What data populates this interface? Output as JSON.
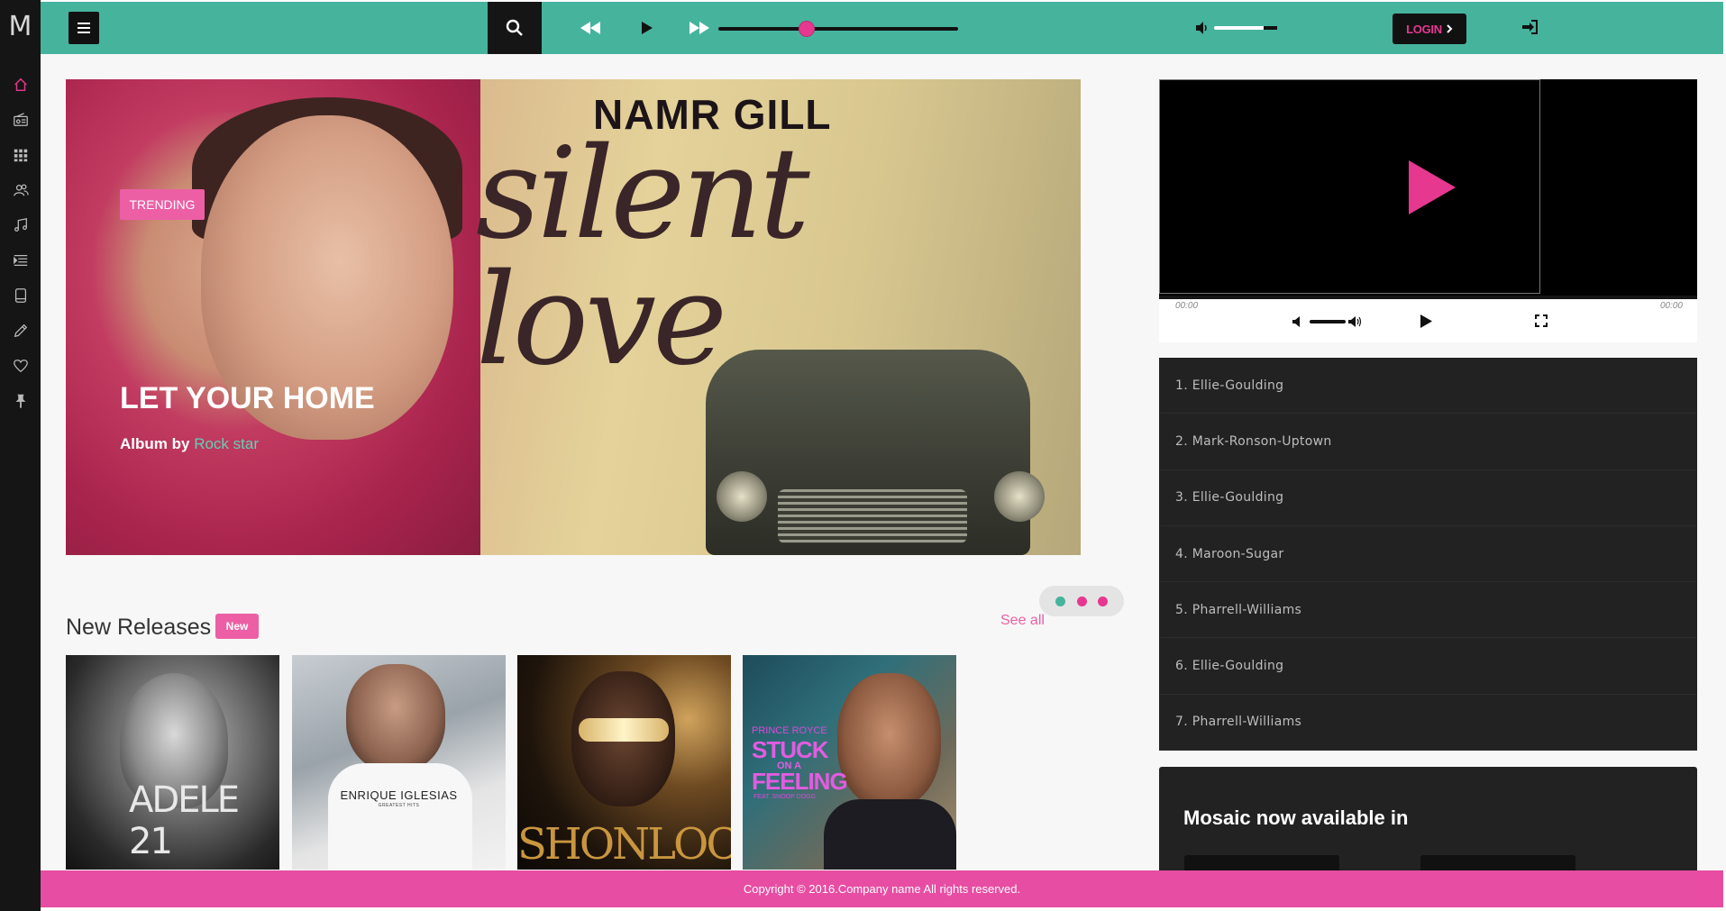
{
  "app": {
    "logo_letter": "M"
  },
  "sidebar": {
    "items": [
      {
        "icon": "home-icon",
        "color": "#e6388f"
      },
      {
        "icon": "radio-icon"
      },
      {
        "icon": "grid-icon"
      },
      {
        "icon": "users-icon"
      },
      {
        "icon": "music-note-icon"
      },
      {
        "icon": "playlist-icon"
      },
      {
        "icon": "tablet-icon"
      },
      {
        "icon": "pencil-icon"
      },
      {
        "icon": "heart-icon"
      },
      {
        "icon": "pin-icon"
      }
    ]
  },
  "topbar": {
    "color": "#46b39d",
    "login_label": "LOGIN",
    "player_progress": 0.37,
    "volume_level": 0.79
  },
  "hero": {
    "artist_text": "NAMR GILL",
    "album_script": "silent love",
    "badge": "TRENDING",
    "title": "LET YOUR HOME",
    "subtitle_prefix": "Album by",
    "subtitle_link": "Rock star"
  },
  "new_releases": {
    "title": "New Releases",
    "badge": "New",
    "see_all": "See all",
    "pager_colors": [
      "#46b39d",
      "#e6388f",
      "#e6388f"
    ],
    "albums": [
      {
        "caption": "ADELE 21"
      },
      {
        "caption": "ENRIQUE IGLESIAS",
        "sub": "GREATEST HITS"
      },
      {
        "caption": "SHONLOCK"
      },
      {
        "caption_line1": "PRINCE ROYCE",
        "caption_line2": "STUCK",
        "caption_line3": "ON A",
        "caption_line4": "FEELING",
        "caption_line5": "FEAT. SNOOP DOGG"
      }
    ]
  },
  "video_player": {
    "current_time": "00:00",
    "duration": "00:00"
  },
  "playlist": {
    "items": [
      "1. Ellie-Goulding",
      "2. Mark-Ronson-Uptown",
      "3. Ellie-Goulding",
      "4. Maroon-Sugar",
      "5. Pharrell-Williams",
      "6. Ellie-Goulding",
      "7. Pharrell-Williams"
    ]
  },
  "promo": {
    "title": "Mosaic now available in"
  },
  "footer": {
    "copyright": "Copyright © 2016.Company name All rights reserved."
  }
}
